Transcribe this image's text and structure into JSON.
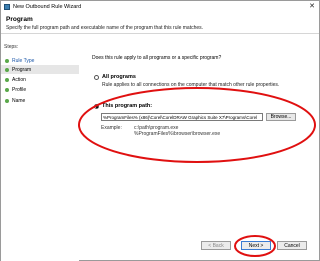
{
  "window": {
    "title": "New Outbound Rule Wizard",
    "close_glyph": "✕"
  },
  "header": {
    "title": "Program",
    "description": "Specify the full program path and executable name of the program that this rule matches."
  },
  "steps": {
    "label": "Steps:",
    "items": [
      {
        "label": "Rule Type",
        "link": true,
        "active": false
      },
      {
        "label": "Program",
        "link": false,
        "active": true
      },
      {
        "label": "Action",
        "link": false,
        "active": false
      },
      {
        "label": "Profile",
        "link": false,
        "active": false
      },
      {
        "label": "Name",
        "link": false,
        "active": false
      }
    ]
  },
  "main": {
    "question": "Does this rule apply to all programs or a specific program?",
    "all_programs": {
      "label": "All programs",
      "description": "Rule applies to all connections on the computer that match other rule properties.",
      "checked": false
    },
    "this_program": {
      "label": "This program path:",
      "checked": true,
      "path_value": "%ProgramFiles% (x86)\\Corel\\CorelDRAW Graphics Suite X7\\Programs\\Corel",
      "browse_label": "Browse..."
    },
    "example": {
      "label": "Example:",
      "line1": "c:\\path\\program.exe",
      "line2": "%ProgramFiles%\\browser\\browser.exe"
    }
  },
  "footer": {
    "back_label": "< Back",
    "next_label": "Next >",
    "cancel_label": "Cancel"
  },
  "colors": {
    "step_dot": "#5aa84a",
    "annotation": "#e01010",
    "link": "#1a56a8"
  }
}
